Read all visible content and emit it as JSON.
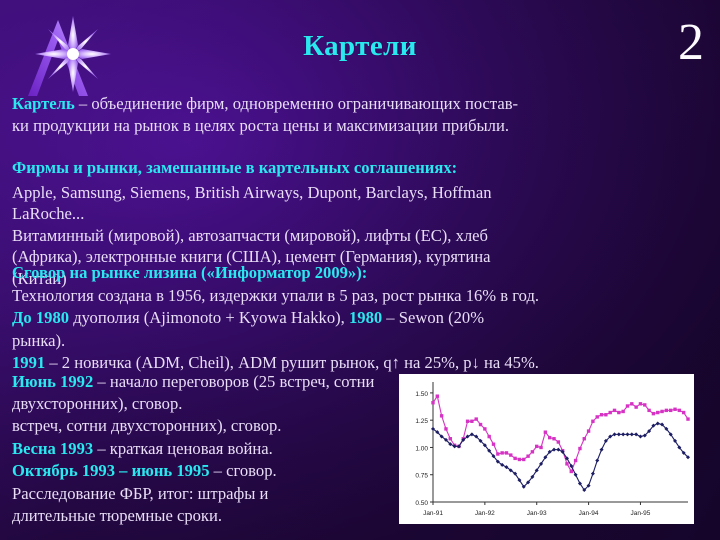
{
  "slide": {
    "title": "Картели",
    "number": "2",
    "logo_icon": "starburst-logo-icon",
    "accent_color": "#2ae8ef",
    "text_color": "#e9ddf7",
    "background_color": "#2a0a52"
  },
  "definition": {
    "term": "Картель",
    "line1_rest": " – объединение фирм, одновременно ограничивающих постав-",
    "line2": "ки продукции на рынок в целях роста цены и максимизации прибыли."
  },
  "firms": {
    "heading": "Фирмы и рынки, замешанные в картельных соглашениях:",
    "line1": "Apple, Samsung, Siemens, British Airways, Dupont, Barclays, Hoffman",
    "line2": "LaRoche...",
    "line3": "Витаминный (мировой), автозапчасти (мировой), лифты (ЕС), хлеб",
    "line4": "(Африка), электронные книги (США), цемент (Германия), курятина",
    "line5": "(Китай)"
  },
  "case": {
    "heading": "Сговор на рынке лизина («Информатор 2009»):",
    "line1": "Технология создана в 1956, издержки упали в 5 раз, рост рынка 16% в год.",
    "line2_accent1": "До 1980",
    "line2_mid": " дуополия (Ajimonoto + Kyowa Hakko), ",
    "line2_accent2": "1980",
    "line2_rest": " – Sewon (20%",
    "line3": "рынка).",
    "line4_accent": "1991",
    "line4_rest": " – 2 новичка (ADM, Cheil), ADM рушит рынок, q↑ на 25%, p↓ на 45%."
  },
  "timeline": {
    "l1_accent": "Июнь 1992",
    "l1_rest": " – начало переговоров (25 встреч, сотни двухсторонних), сговор.",
    "l1_wrap": "встреч, сотни двухсторонних), сговор.",
    "l2_accent": "Весна 1993",
    "l2_rest": " – краткая ценовая война.",
    "l3_accent": "Октябрь 1993 – июнь 1995",
    "l3_rest": " – сговор.",
    "l4": "Расследование ФБР, итог: штрафы и",
    "l5": "длительные тюремные сроки."
  },
  "chart_data": {
    "type": "line",
    "title": "",
    "xlabel": "",
    "ylabel": "",
    "ylim": [
      0.5,
      1.6
    ],
    "yticks": [
      0.5,
      0.75,
      1.0,
      1.25,
      1.5
    ],
    "ytick_labels": [
      "0.50",
      "0.75",
      "1.00",
      "1.25",
      "1.50"
    ],
    "xticks": [
      0,
      12,
      24,
      36,
      48
    ],
    "xtick_labels": [
      "Jan-91",
      "Jan-92",
      "Jan-93",
      "Jan-94",
      "Jan-95"
    ],
    "grid": false,
    "legend": "none",
    "n_points": 60,
    "series": [
      {
        "name": "series-magenta",
        "color": "#d633c4",
        "marker": "square",
        "values": [
          1.41,
          1.47,
          1.29,
          1.17,
          1.08,
          1.02,
          1.01,
          1.08,
          1.24,
          1.24,
          1.26,
          1.21,
          1.17,
          1.1,
          1.03,
          0.94,
          0.95,
          0.95,
          0.93,
          0.9,
          0.89,
          0.89,
          0.92,
          0.96,
          1.01,
          1.0,
          1.14,
          1.09,
          1.08,
          1.05,
          0.97,
          0.85,
          0.78,
          0.88,
          0.99,
          1.08,
          1.15,
          1.24,
          1.28,
          1.3,
          1.3,
          1.32,
          1.34,
          1.32,
          1.33,
          1.38,
          1.4,
          1.37,
          1.4,
          1.39,
          1.34,
          1.31,
          1.32,
          1.33,
          1.34,
          1.34,
          1.35,
          1.34,
          1.32,
          1.26
        ]
      },
      {
        "name": "series-navy",
        "color": "#1c1d63",
        "marker": "diamond",
        "values": [
          1.17,
          1.14,
          1.1,
          1.07,
          1.03,
          1.01,
          1.01,
          1.07,
          1.1,
          1.12,
          1.1,
          1.06,
          1.02,
          0.97,
          0.92,
          0.87,
          0.84,
          0.82,
          0.79,
          0.76,
          0.7,
          0.64,
          0.68,
          0.73,
          0.79,
          0.85,
          0.91,
          0.96,
          0.98,
          0.98,
          0.96,
          0.9,
          0.83,
          0.75,
          0.67,
          0.61,
          0.65,
          0.76,
          0.88,
          0.98,
          1.06,
          1.1,
          1.12,
          1.12,
          1.12,
          1.12,
          1.12,
          1.12,
          1.1,
          1.11,
          1.15,
          1.2,
          1.22,
          1.21,
          1.17,
          1.12,
          1.06,
          1.0,
          0.95,
          0.91
        ]
      }
    ]
  }
}
